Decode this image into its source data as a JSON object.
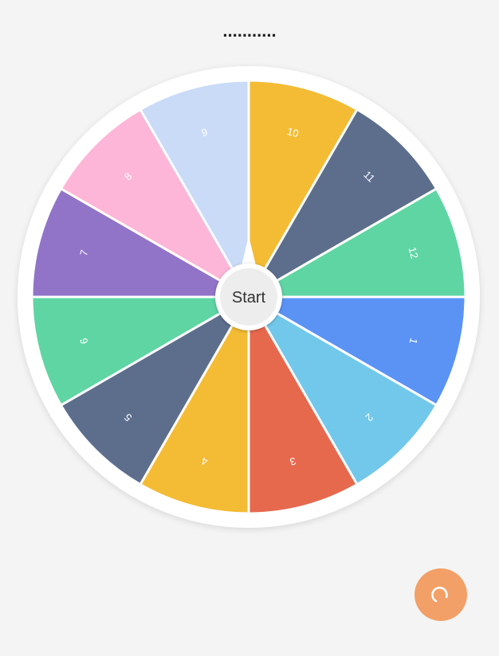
{
  "header": {
    "title": "..........."
  },
  "wheel": {
    "start_label": "Start",
    "segments": [
      {
        "label": "1",
        "color": "#5b93f5"
      },
      {
        "label": "2",
        "color": "#72c8ea"
      },
      {
        "label": "3",
        "color": "#e6694e"
      },
      {
        "label": "4",
        "color": "#f4bb34"
      },
      {
        "label": "5",
        "color": "#5d6e8d"
      },
      {
        "label": "6",
        "color": "#5fd5a4"
      },
      {
        "label": "7",
        "color": "#9174c8"
      },
      {
        "label": "8",
        "color": "#fdb6d7"
      },
      {
        "label": "9",
        "color": "#c9dbf7"
      },
      {
        "label": "10",
        "color": "#f4bb34"
      },
      {
        "label": "11",
        "color": "#5d6e8d"
      },
      {
        "label": "12",
        "color": "#5fd5a4"
      }
    ],
    "rim_color": "#ffffff",
    "hub_color": "#ededed"
  },
  "fab": {
    "icon": "reset-icon",
    "color": "#f2a068"
  }
}
